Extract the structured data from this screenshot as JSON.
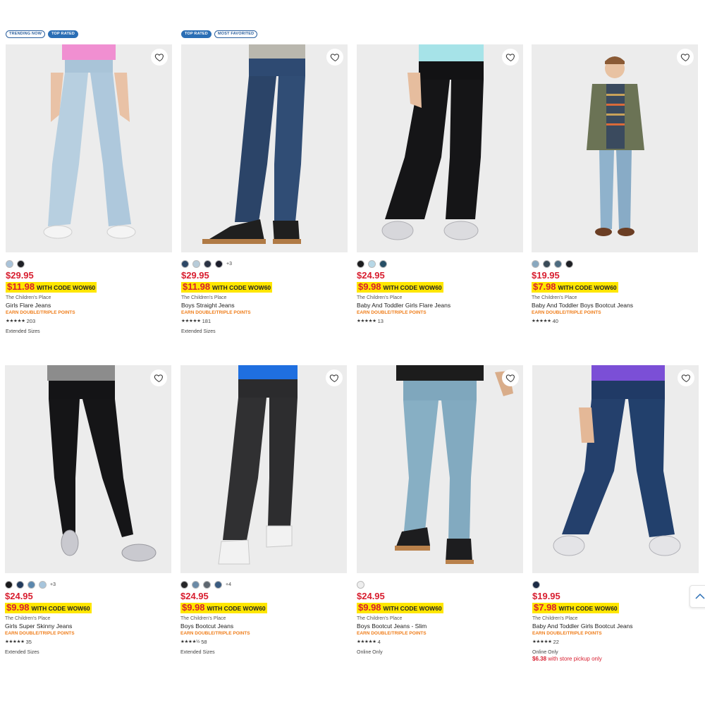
{
  "products": [
    {
      "badges": [
        "TRENDING NOW",
        "TOP RATED"
      ],
      "swatches": [
        "#a9c3d9",
        "#1f2126"
      ],
      "more": "",
      "price": "$29.95",
      "promo_price": "$11.98",
      "promo_code": "WITH CODE WOW60",
      "brand": "The Children's Place",
      "name": "Girls Flare Jeans",
      "points": "EARN DOUBLE/TRIPLE POINTS",
      "stars": "★★★★★",
      "reviews": "203",
      "note": "Extended Sizes",
      "pickup_price": "",
      "pickup_text": ""
    },
    {
      "badges": [
        "TOP RATED",
        "MOST FAVORITED"
      ],
      "swatches": [
        "#2d4766",
        "#b8ccd9",
        "#2b3344",
        "#1b1d2b"
      ],
      "more": "+3",
      "price": "$29.95",
      "promo_price": "$11.98",
      "promo_code": "WITH CODE WOW60",
      "brand": "The Children's Place",
      "name": "Boys Straight Jeans",
      "points": "EARN DOUBLE/TRIPLE POINTS",
      "stars": "★★★★★",
      "reviews": "181",
      "note": "Extended Sizes",
      "pickup_price": "",
      "pickup_text": ""
    },
    {
      "badges": [],
      "swatches": [
        "#1c1c1e",
        "#b7d7e6",
        "#274f66"
      ],
      "more": "",
      "price": "$24.95",
      "promo_price": "$9.98",
      "promo_code": "WITH CODE WOW60",
      "brand": "The Children's Place",
      "name": "Baby And Toddler Girls Flare Jeans",
      "points": "EARN DOUBLE/TRIPLE POINTS",
      "stars": "★★★★★",
      "reviews": "13",
      "note": "",
      "pickup_price": "",
      "pickup_text": ""
    },
    {
      "badges": [],
      "swatches": [
        "#89a8bf",
        "#394a57",
        "#4d6b80",
        "#1e1f24"
      ],
      "more": "",
      "price": "$19.95",
      "promo_price": "$7.98",
      "promo_code": "WITH CODE WOW60",
      "brand": "The Children's Place",
      "name": "Baby And Toddler Boys Bootcut Jeans",
      "points": "EARN DOUBLE/TRIPLE POINTS",
      "stars": "★★★★★",
      "reviews": "40",
      "note": "",
      "pickup_price": "",
      "pickup_text": ""
    },
    {
      "badges": [],
      "swatches": [
        "#1a1a1c",
        "#223a5c",
        "#5b87ad",
        "#a7c5dc"
      ],
      "more": "+3",
      "price": "$24.95",
      "promo_price": "$9.98",
      "promo_code": "WITH CODE WOW60",
      "brand": "The Children's Place",
      "name": "Girls Super Skinny Jeans",
      "points": "EARN DOUBLE/TRIPLE POINTS",
      "stars": "★★★★★",
      "reviews": "35",
      "note": "Extended Sizes",
      "pickup_price": "",
      "pickup_text": ""
    },
    {
      "badges": [],
      "swatches": [
        "#262628",
        "#6b8aa6",
        "#5e6770",
        "#3a5b80"
      ],
      "more": "+4",
      "price": "$24.95",
      "promo_price": "$9.98",
      "promo_code": "WITH CODE WOW60",
      "brand": "The Children's Place",
      "name": "Boys Bootcut Jeans",
      "points": "EARN DOUBLE/TRIPLE POINTS",
      "stars": "★★★★½",
      "reviews": "58",
      "note": "Extended Sizes",
      "pickup_price": "",
      "pickup_text": ""
    },
    {
      "badges": [],
      "swatches": [
        "#eeeeee"
      ],
      "more": "",
      "price": "$24.95",
      "promo_price": "$9.98",
      "promo_code": "WITH CODE WOW60",
      "brand": "The Children's Place",
      "name": "Boys Bootcut Jeans - Slim",
      "points": "EARN DOUBLE/TRIPLE POINTS",
      "stars": "★★★★★",
      "reviews": "4",
      "note": "Online Only",
      "pickup_price": "",
      "pickup_text": ""
    },
    {
      "badges": [],
      "swatches": [
        "#1c2b45"
      ],
      "more": "",
      "price": "$19.95",
      "promo_price": "$7.98",
      "promo_code": "WITH CODE WOW60",
      "brand": "The Children's Place",
      "name": "Baby And Toddler Girls Bootcut Jeans",
      "points": "EARN DOUBLE/TRIPLE POINTS",
      "stars": "★★★★★",
      "reviews": "22",
      "note": "Online Only",
      "pickup_price": "$6.38",
      "pickup_text": "with store pickup only"
    }
  ],
  "colors": {
    "price_red": "#d81e2f",
    "promo_highlight": "#ffe600",
    "points_orange": "#ef7d1a",
    "badge_blue": "#2a6eb5"
  },
  "icons": {
    "favorite": "heart-outline-icon",
    "scroll_top": "chevron-up-icon"
  }
}
